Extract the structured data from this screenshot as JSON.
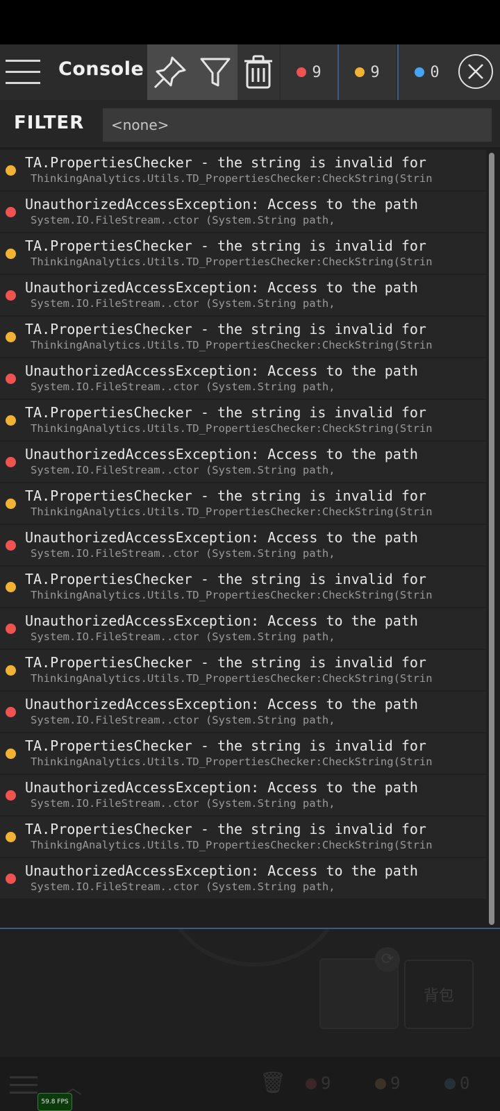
{
  "console": {
    "title": "Console",
    "filter_label": "FILTER",
    "filter_placeholder": "<none>",
    "counters": [
      {
        "color": "#ef5350",
        "count": "9"
      },
      {
        "color": "#f2b233",
        "count": "9"
      },
      {
        "color": "#42a5f5",
        "count": "0"
      }
    ]
  },
  "logs": [
    {
      "level": "warning",
      "color": "#f2b233",
      "message": "TA.PropertiesChecker - the string is invalid for",
      "trace": "ThinkingAnalytics.Utils.TD_PropertiesChecker:CheckString(Strin"
    },
    {
      "level": "error",
      "color": "#ef5350",
      "message": "UnauthorizedAccessException: Access to the path",
      "trace": "System.IO.FileStream..ctor (System.String path,"
    },
    {
      "level": "warning",
      "color": "#f2b233",
      "message": "TA.PropertiesChecker - the string is invalid for",
      "trace": "ThinkingAnalytics.Utils.TD_PropertiesChecker:CheckString(Strin"
    },
    {
      "level": "error",
      "color": "#ef5350",
      "message": "UnauthorizedAccessException: Access to the path",
      "trace": "System.IO.FileStream..ctor (System.String path,"
    },
    {
      "level": "warning",
      "color": "#f2b233",
      "message": "TA.PropertiesChecker - the string is invalid for",
      "trace": "ThinkingAnalytics.Utils.TD_PropertiesChecker:CheckString(Strin"
    },
    {
      "level": "error",
      "color": "#ef5350",
      "message": "UnauthorizedAccessException: Access to the path",
      "trace": "System.IO.FileStream..ctor (System.String path,"
    },
    {
      "level": "warning",
      "color": "#f2b233",
      "message": "TA.PropertiesChecker - the string is invalid for",
      "trace": "ThinkingAnalytics.Utils.TD_PropertiesChecker:CheckString(Strin"
    },
    {
      "level": "error",
      "color": "#ef5350",
      "message": "UnauthorizedAccessException: Access to the path",
      "trace": "System.IO.FileStream..ctor (System.String path,"
    },
    {
      "level": "warning",
      "color": "#f2b233",
      "message": "TA.PropertiesChecker - the string is invalid for",
      "trace": "ThinkingAnalytics.Utils.TD_PropertiesChecker:CheckString(Strin"
    },
    {
      "level": "error",
      "color": "#ef5350",
      "message": "UnauthorizedAccessException: Access to the path",
      "trace": "System.IO.FileStream..ctor (System.String path,"
    },
    {
      "level": "warning",
      "color": "#f2b233",
      "message": "TA.PropertiesChecker - the string is invalid for",
      "trace": "ThinkingAnalytics.Utils.TD_PropertiesChecker:CheckString(Strin"
    },
    {
      "level": "error",
      "color": "#ef5350",
      "message": "UnauthorizedAccessException: Access to the path",
      "trace": "System.IO.FileStream..ctor (System.String path,"
    },
    {
      "level": "warning",
      "color": "#f2b233",
      "message": "TA.PropertiesChecker - the string is invalid for",
      "trace": "ThinkingAnalytics.Utils.TD_PropertiesChecker:CheckString(Strin"
    },
    {
      "level": "error",
      "color": "#ef5350",
      "message": "UnauthorizedAccessException: Access to the path",
      "trace": "System.IO.FileStream..ctor (System.String path,"
    },
    {
      "level": "warning",
      "color": "#f2b233",
      "message": "TA.PropertiesChecker - the string is invalid for",
      "trace": "ThinkingAnalytics.Utils.TD_PropertiesChecker:CheckString(Strin"
    },
    {
      "level": "error",
      "color": "#ef5350",
      "message": "UnauthorizedAccessException: Access to the path",
      "trace": "System.IO.FileStream..ctor (System.String path,"
    },
    {
      "level": "warning",
      "color": "#f2b233",
      "message": "TA.PropertiesChecker - the string is invalid for",
      "trace": "ThinkingAnalytics.Utils.TD_PropertiesChecker:CheckString(Strin"
    },
    {
      "level": "error",
      "color": "#ef5350",
      "message": "UnauthorizedAccessException: Access to the path",
      "trace": "System.IO.FileStream..ctor (System.String path,"
    }
  ],
  "background": {
    "bag_label": "背包",
    "fps": "59.8 FPS",
    "counters": [
      "9",
      "9",
      "0"
    ]
  }
}
